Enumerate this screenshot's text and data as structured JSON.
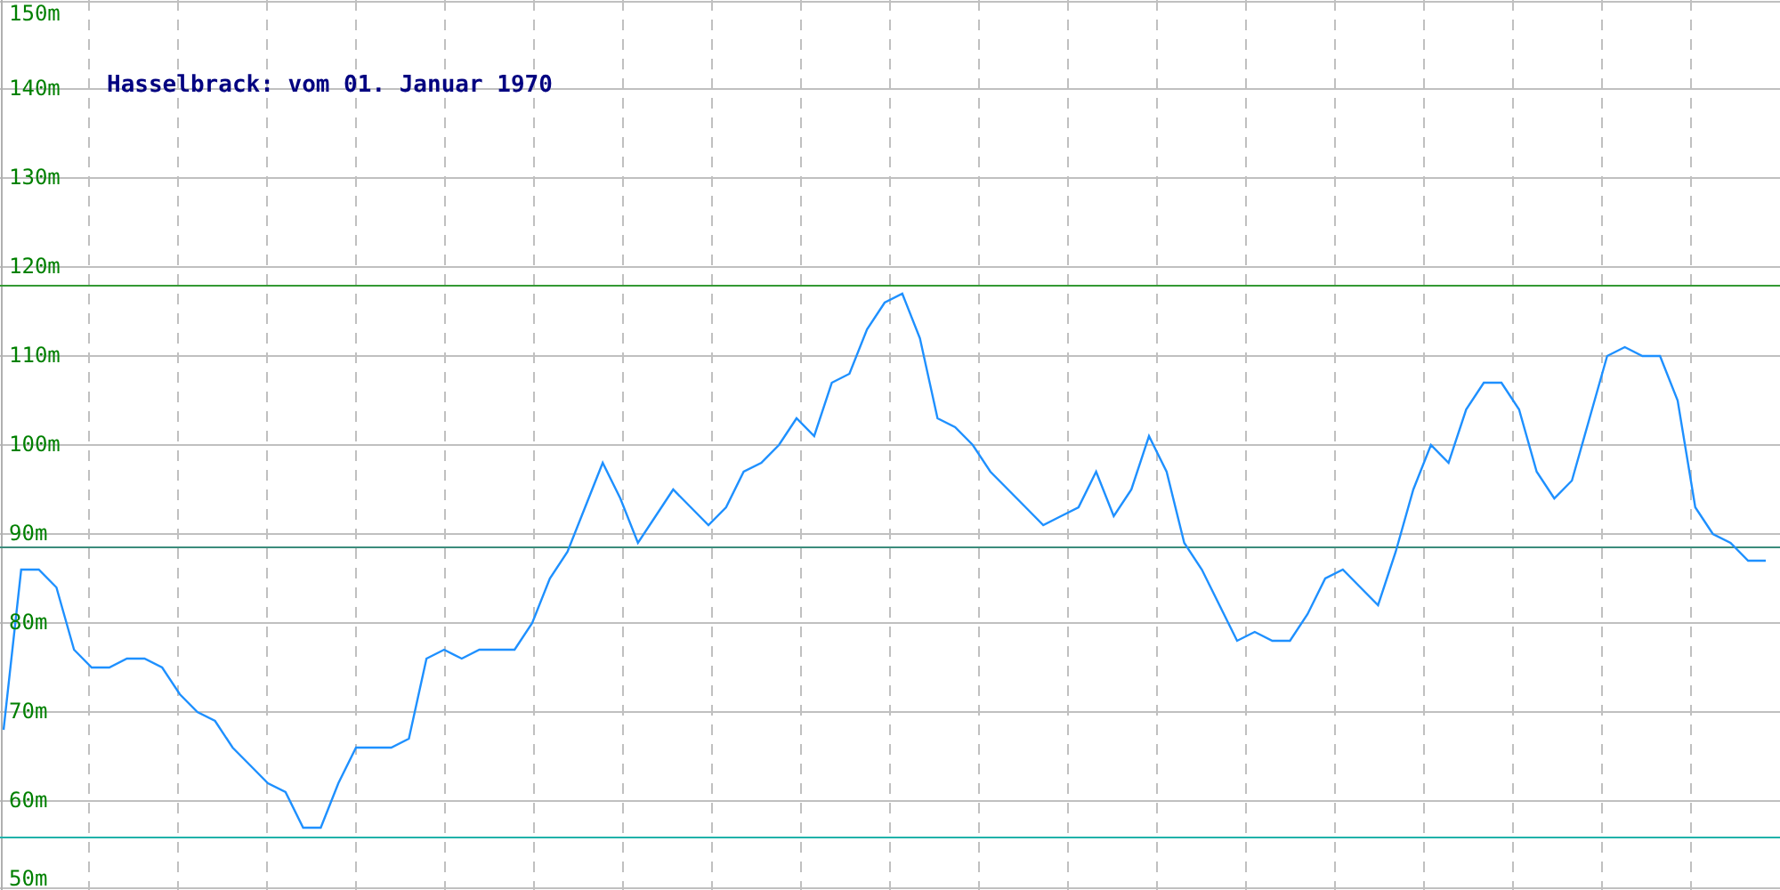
{
  "chart_data": {
    "type": "line",
    "title": "Hasselbrack: vom 01. Januar 1970",
    "ylim": [
      50,
      150
    ],
    "yticks": [
      {
        "value": 50,
        "label": "50m"
      },
      {
        "value": 60,
        "label": "60m"
      },
      {
        "value": 70,
        "label": "70m"
      },
      {
        "value": 80,
        "label": "80m"
      },
      {
        "value": 90,
        "label": "90m"
      },
      {
        "value": 100,
        "label": "100m"
      },
      {
        "value": 110,
        "label": "110m"
      },
      {
        "value": 120,
        "label": "120m"
      },
      {
        "value": 130,
        "label": "130m"
      },
      {
        "value": 140,
        "label": "140m"
      },
      {
        "value": 150,
        "label": "150m"
      }
    ],
    "series": [
      {
        "color": "#1e90ff",
        "values": [
          68,
          86,
          86,
          84,
          77,
          75,
          75,
          76,
          76,
          75,
          72,
          70,
          69,
          66,
          64,
          62,
          61,
          57,
          57,
          62,
          66,
          66,
          66,
          67,
          76,
          77,
          76,
          77,
          77,
          77,
          80,
          85,
          88,
          93,
          98,
          94,
          89,
          92,
          95,
          93,
          91,
          93,
          97,
          98,
          100,
          103,
          101,
          107,
          108,
          113,
          116,
          117,
          112,
          103,
          102,
          100,
          97,
          95,
          93,
          91,
          92,
          93,
          97,
          92,
          95,
          101,
          97,
          89,
          86,
          82,
          78,
          79,
          78,
          78,
          81,
          85,
          86,
          84,
          82,
          88,
          95,
          100,
          98,
          104,
          107,
          107,
          104,
          97,
          94,
          96,
          103,
          110,
          111,
          110,
          110,
          105,
          93,
          90,
          89,
          87,
          87
        ]
      }
    ],
    "grid": true,
    "ref_lines": [
      {
        "axis": "y",
        "value": 118,
        "color": "#339933"
      },
      {
        "axis": "y",
        "value": 88.6,
        "color": "#3c8c7c"
      },
      {
        "axis": "y",
        "value": 56,
        "color": "#20b2aa"
      }
    ]
  }
}
